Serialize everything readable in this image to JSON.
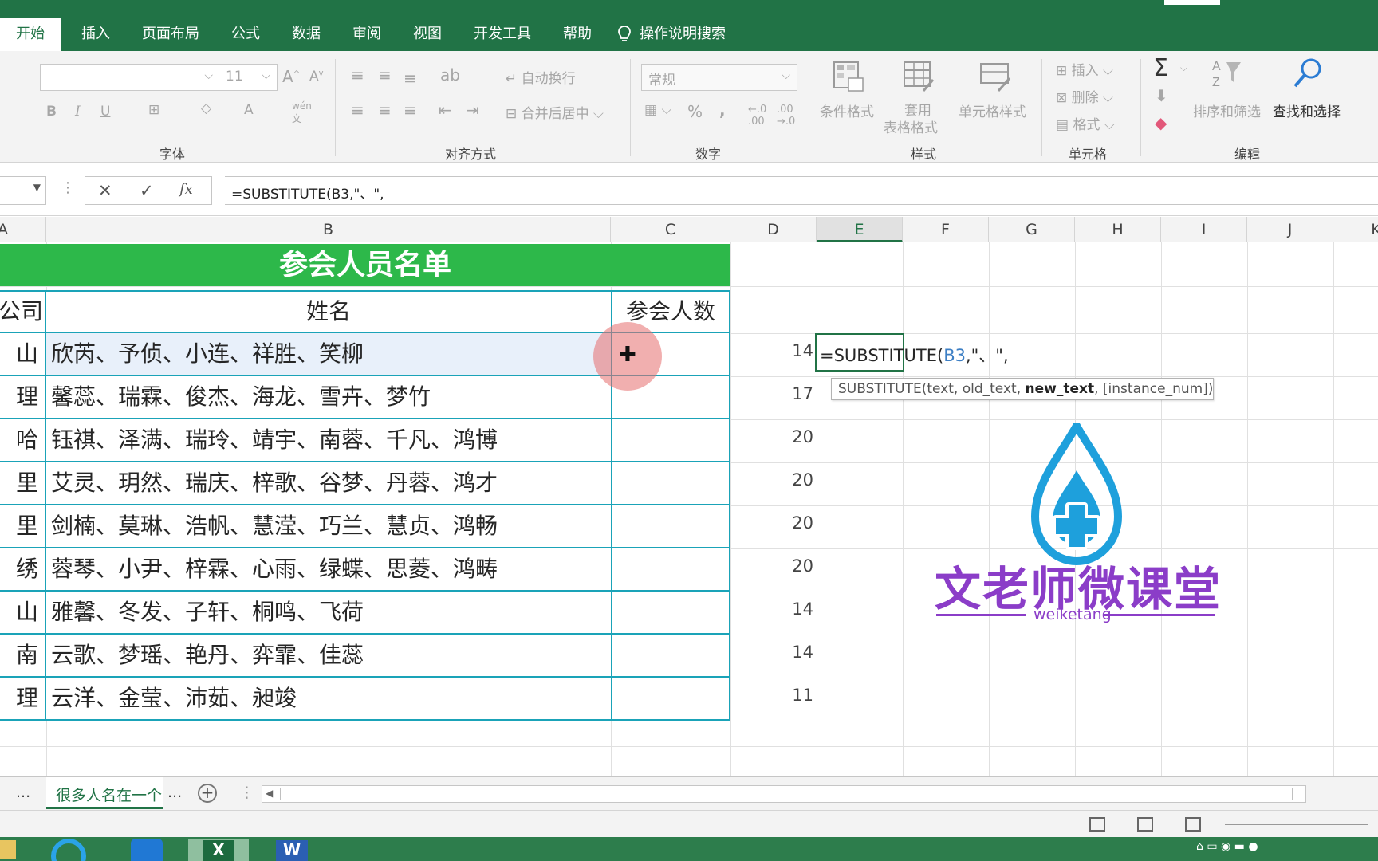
{
  "tabs": {
    "items": [
      "开始",
      "插入",
      "页面布局",
      "公式",
      "数据",
      "审阅",
      "视图",
      "开发工具",
      "帮助"
    ],
    "search": "操作说明搜索"
  },
  "ribbon": {
    "font_size": "11",
    "number_format": "常规",
    "wrap_text": "自动换行",
    "merge_center": "合并后居中",
    "cond_format": "条件格式",
    "table_format_1": "套用",
    "table_format_2": "表格格式",
    "cell_style": "单元格样式",
    "insert": "插入",
    "delete": "删除",
    "format": "格式",
    "sort_filter": "排序和筛选",
    "find_select": "查找和选择",
    "percent": "%",
    "comma": ",",
    "groups": {
      "font": "字体",
      "alignment": "对齐方式",
      "number": "数字",
      "styles": "样式",
      "cells": "单元格",
      "editing": "编辑"
    }
  },
  "formula_bar": {
    "fx": "fx",
    "formula": "=SUBSTITUTE(B3,\"、\","
  },
  "columns": [
    "A",
    "B",
    "C",
    "D",
    "E",
    "F",
    "G",
    "H",
    "I",
    "J",
    "K"
  ],
  "sheet": {
    "title": "参会人员名单",
    "headers": {
      "a": "公司",
      "b": "姓名",
      "c": "参会人数"
    },
    "rows": [
      {
        "a": "山",
        "b": "欣芮、予侦、小连、祥胜、笑柳",
        "d": "14"
      },
      {
        "a": "理",
        "b": "馨蕊、瑞霖、俊杰、海龙、雪卉、梦竹",
        "d": "17"
      },
      {
        "a": "哈",
        "b": "钰祺、泽满、瑞玲、靖宇、南蓉、千凡、鸿博",
        "d": "20"
      },
      {
        "a": "里",
        "b": "艾灵、玥然、瑞庆、梓歌、谷梦、丹蓉、鸿才",
        "d": "20"
      },
      {
        "a": "里",
        "b": "剑楠、莫琳、浩帆、慧滢、巧兰、慧贞、鸿畅",
        "d": "20"
      },
      {
        "a": "绣",
        "b": "蓉琴、小尹、梓霖、心雨、绿蝶、思菱、鸿畴",
        "d": "20"
      },
      {
        "a": "山",
        "b": "雅馨、冬发、子轩、桐鸣、飞荷",
        "d": "14"
      },
      {
        "a": "南",
        "b": "云歌、梦瑶、艳丹、弈霏、佳蕊",
        "d": "14"
      },
      {
        "a": "理",
        "b": "云洋、金莹、沛茹、昶竣",
        "d": "11"
      }
    ]
  },
  "active_cell": {
    "fn": "=SUBSTITUTE(",
    "arg": "B3",
    "rest": ",\"、\","
  },
  "tooltip": {
    "fn": "SUBSTITUTE(text, old_text, ",
    "current": "new_text",
    "rest": ", [instance_num])"
  },
  "logo": {
    "title": "文老师微课堂",
    "subtitle": "weiketang"
  },
  "sheet_tabs": {
    "ellipsis": "...",
    "active": "很多人名在一个",
    "add": "+"
  },
  "colors": {
    "excel_green": "#217346",
    "title_band": "#2db84a",
    "table_border": "#1aa3b8",
    "logo_purple": "#8b3dc8",
    "logo_blue": "#1ea0dc"
  }
}
